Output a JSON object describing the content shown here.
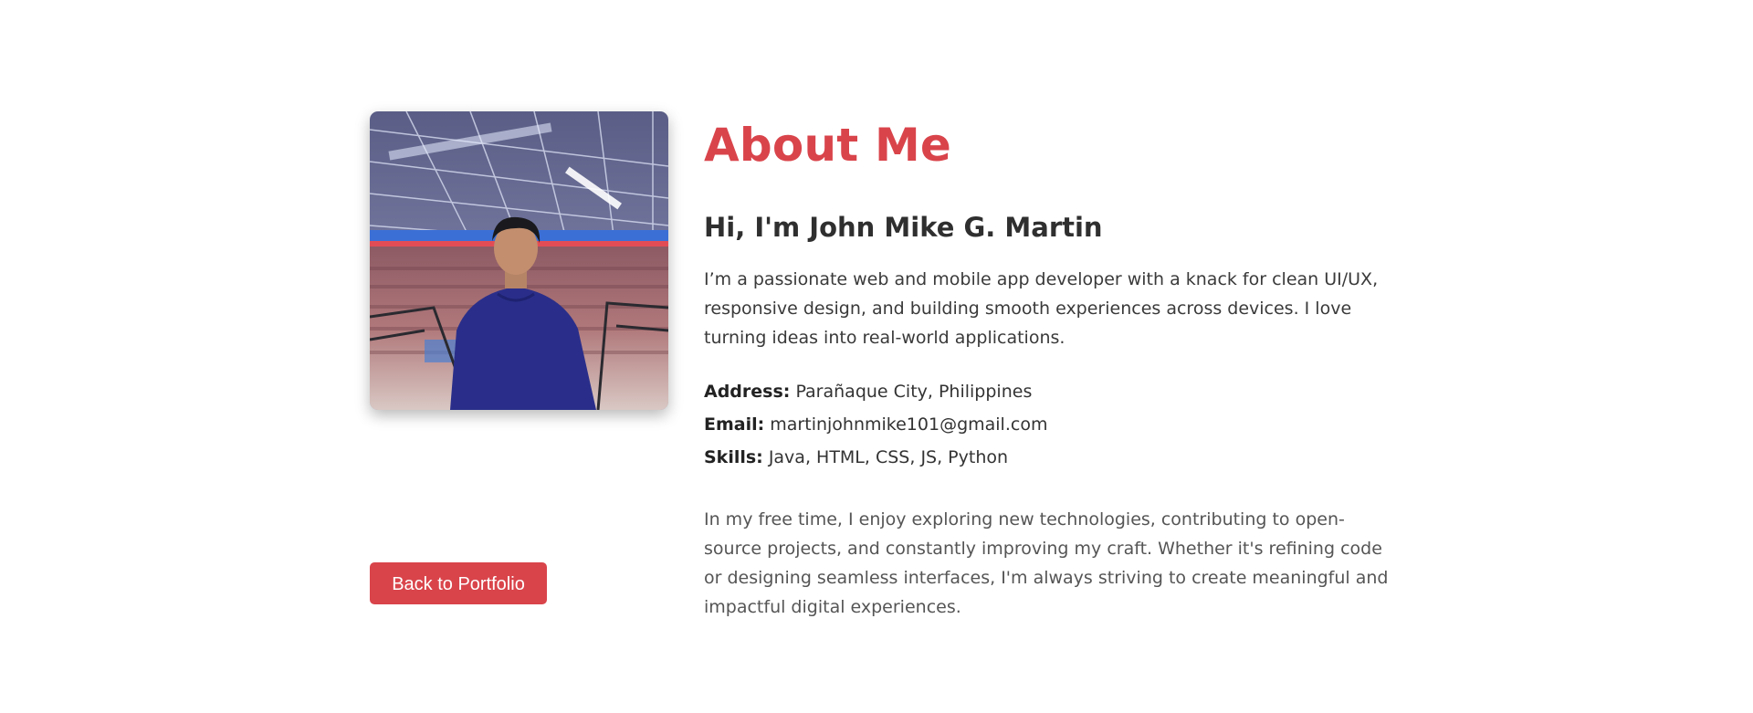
{
  "about": {
    "title": "About Me",
    "greeting": "Hi, I'm John Mike G. Martin",
    "bio": "I’m a passionate web and mobile app developer with a knack for clean UI/UX, responsive design, and building smooth experiences across devices. I love turning ideas into real-world applications.",
    "details": [
      {
        "label": "Address:",
        "value": "Parañaque City, Philippines"
      },
      {
        "label": "Email:",
        "value": "martinjohnmike101@gmail.com"
      },
      {
        "label": "Skills:",
        "value": "Java, HTML, CSS, JS, Python"
      }
    ],
    "extra": "In my free time, I enjoy exploring new technologies, contributing to open-source projects, and constantly improving my craft. Whether it's refining code or designing seamless interfaces, I'm always striving to create meaningful and impactful digital experiences."
  },
  "actions": {
    "back_label": "Back to Portfolio"
  },
  "colors": {
    "accent": "#d9444b",
    "heading": "#2f2f2f",
    "text": "#3a3a3a",
    "muted": "#555555"
  },
  "photo": {
    "icon": "profile-photo"
  }
}
